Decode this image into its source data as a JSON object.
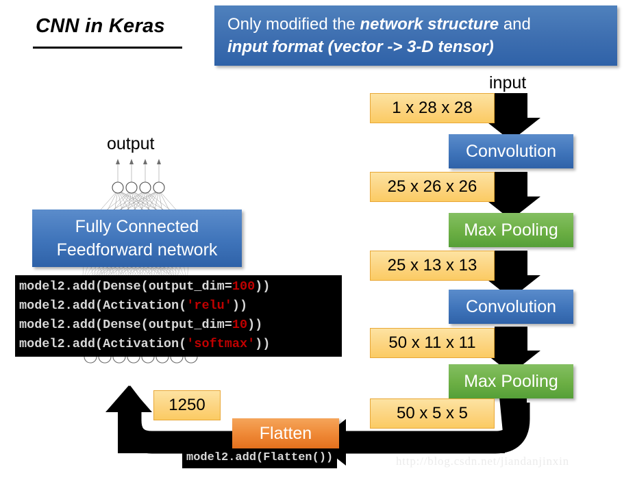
{
  "slide": {
    "title": "CNN in Keras",
    "watermark": "http://blog.csdn.net/jiandanjinxin"
  },
  "banner": {
    "line1_prefix": "Only modified the ",
    "line1_bold": "network structure",
    "line1_suffix": " and",
    "line2": "input format (vector -> 3-D tensor)",
    "bg_color": "#3f74ba",
    "text_color": "#ffffff"
  },
  "left_panel": {
    "output_label": "output",
    "fc_line1": "Fully Connected",
    "fc_line2": "Feedforward network",
    "code_lines": [
      {
        "pre": "model2.add(Dense(output_dim=",
        "hl": "100",
        "post": "))"
      },
      {
        "pre": "model2.add(Activation(",
        "hl": "'relu'",
        "post": "))"
      },
      {
        "pre": "model2.add(Dense(output_dim=",
        "hl": "10",
        "post": "))"
      },
      {
        "pre": "model2.add(Activation(",
        "hl": "'softmax'",
        "post": "))"
      }
    ],
    "flatten_code": "model2.add(Flatten())"
  },
  "pipeline": {
    "input_label": "input",
    "tensor_1": "1 x 28 x 28",
    "layer_conv_1": "Convolution",
    "tensor_2": "25 x 26 x 26",
    "layer_pool_1": "Max Pooling",
    "tensor_3": "25 x 13 x 13",
    "layer_conv_2": "Convolution",
    "tensor_4": "50 x 11 x 11",
    "layer_pool_2": "Max Pooling",
    "tensor_5": "50 x 5 x 5",
    "flatten_label": "Flatten",
    "flatten_out": "1250",
    "colors": {
      "tensor": "#fcd480",
      "conv": "#3f74ba",
      "pool": "#6caf44",
      "flatten": "#ef8a38",
      "arrow": "#000000"
    }
  }
}
